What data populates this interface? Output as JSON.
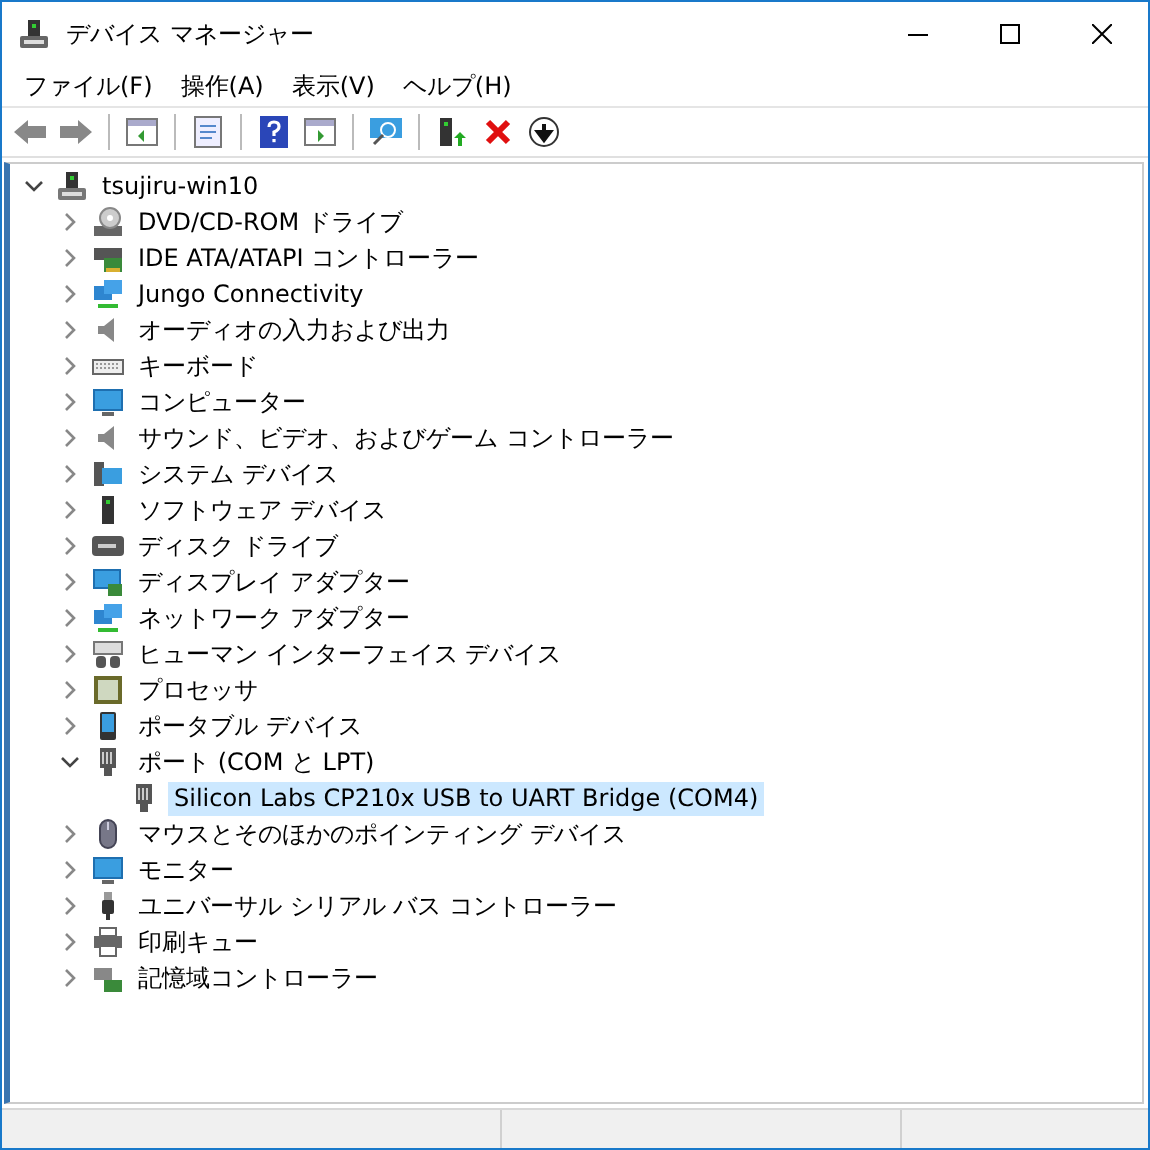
{
  "window": {
    "title": "デバイス マネージャー"
  },
  "menu": [
    {
      "label": "ファイル(F)"
    },
    {
      "label": "操作(A)"
    },
    {
      "label": "表示(V)"
    },
    {
      "label": "ヘルプ(H)"
    }
  ],
  "tree": {
    "label": "tsujiru-win10",
    "expanded": true,
    "selected": false,
    "children": [
      {
        "label": "DVD/CD-ROM ドライブ",
        "expanded": false,
        "selected": false
      },
      {
        "label": "IDE ATA/ATAPI コントローラー",
        "expanded": false,
        "selected": false
      },
      {
        "label": "Jungo Connectivity",
        "expanded": false,
        "selected": false
      },
      {
        "label": "オーディオの入力および出力",
        "expanded": false,
        "selected": false
      },
      {
        "label": "キーボード",
        "expanded": false,
        "selected": false
      },
      {
        "label": "コンピューター",
        "expanded": false,
        "selected": false
      },
      {
        "label": "サウンド、ビデオ、およびゲーム コントローラー",
        "expanded": false,
        "selected": false
      },
      {
        "label": "システム デバイス",
        "expanded": false,
        "selected": false
      },
      {
        "label": "ソフトウェア デバイス",
        "expanded": false,
        "selected": false
      },
      {
        "label": "ディスク ドライブ",
        "expanded": false,
        "selected": false
      },
      {
        "label": "ディスプレイ アダプター",
        "expanded": false,
        "selected": false
      },
      {
        "label": "ネットワーク アダプター",
        "expanded": false,
        "selected": false
      },
      {
        "label": "ヒューマン インターフェイス デバイス",
        "expanded": false,
        "selected": false
      },
      {
        "label": "プロセッサ",
        "expanded": false,
        "selected": false
      },
      {
        "label": "ポータブル デバイス",
        "expanded": false,
        "selected": false
      },
      {
        "label": "ポート (COM と LPT)",
        "expanded": true,
        "selected": false,
        "children": [
          {
            "label": "Silicon Labs CP210x USB to UART Bridge (COM4)",
            "selected": true
          }
        ]
      },
      {
        "label": "マウスとそのほかのポインティング デバイス",
        "expanded": false,
        "selected": false
      },
      {
        "label": "モニター",
        "expanded": false,
        "selected": false
      },
      {
        "label": "ユニバーサル シリアル バス コントローラー",
        "expanded": false,
        "selected": false
      },
      {
        "label": "印刷キュー",
        "expanded": false,
        "selected": false
      },
      {
        "label": "記憶域コントローラー",
        "expanded": false,
        "selected": false
      }
    ]
  }
}
